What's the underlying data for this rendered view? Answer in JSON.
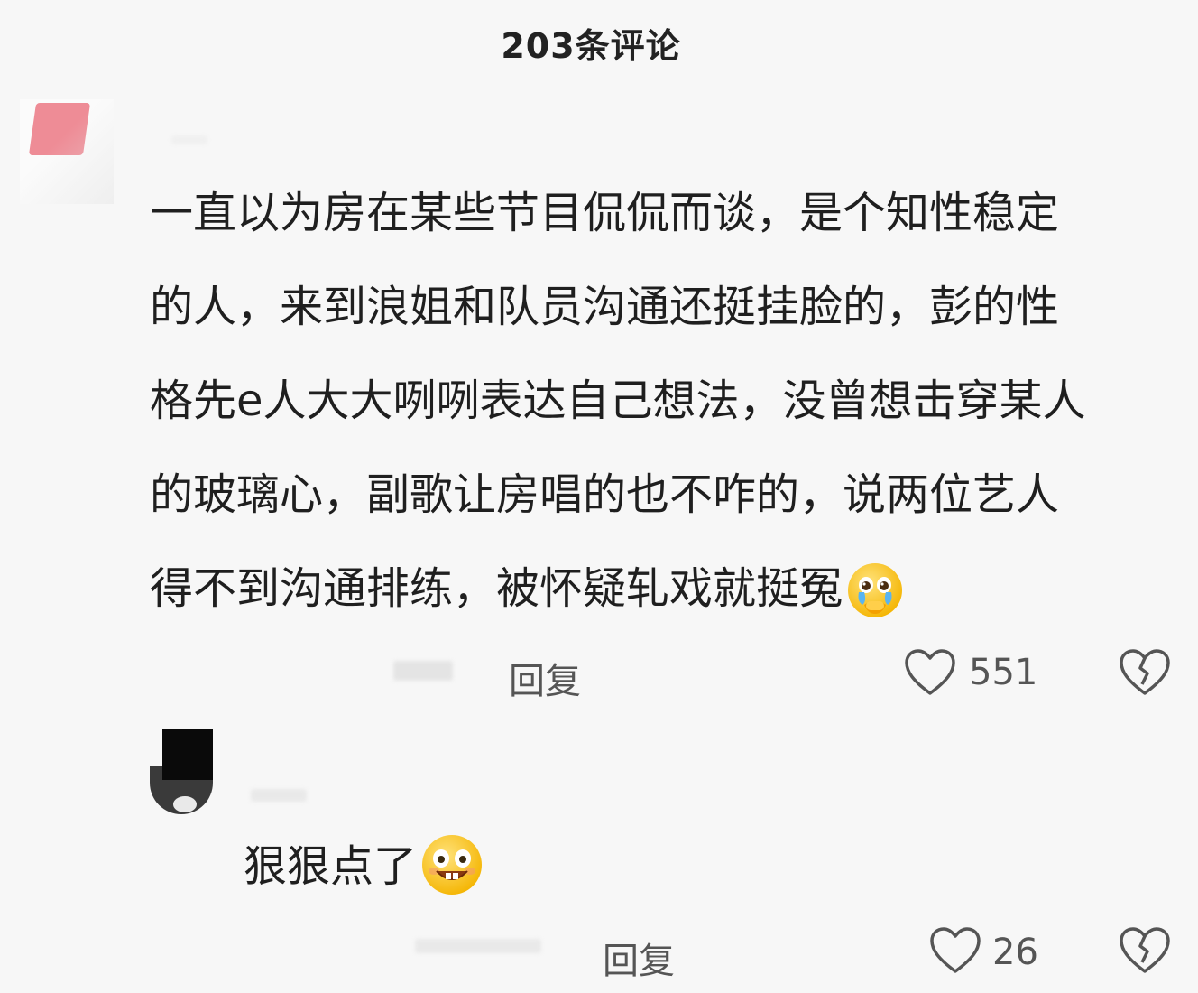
{
  "header": {
    "title": "203条评论"
  },
  "comments": [
    {
      "text_lines": [
        "一直以为房在某些节目侃侃而谈，是个知性稳定",
        "的人，来到浪姐和队员沟通还挺挂脸的，彭的性",
        "格先e人大大咧咧表达自己想法，没曾想击穿某人",
        "的玻璃心，副歌让房唱的也不咋的，说两位艺人",
        "得不到沟通排练，被怀疑轧戏就挺冤"
      ],
      "emoji": "crying-face-emoji",
      "reply_label": "回复",
      "likes": "551"
    },
    {
      "text": "狠狠点了",
      "emoji": "grinning-face-emoji",
      "reply_label": "回复",
      "likes": "26"
    }
  ],
  "colors": {
    "background": "#f7f7f7",
    "text": "#1f1f1f",
    "secondary": "#555555",
    "avatar_accent": "#ee8c96",
    "emoji_yellow": "#f7c948"
  }
}
